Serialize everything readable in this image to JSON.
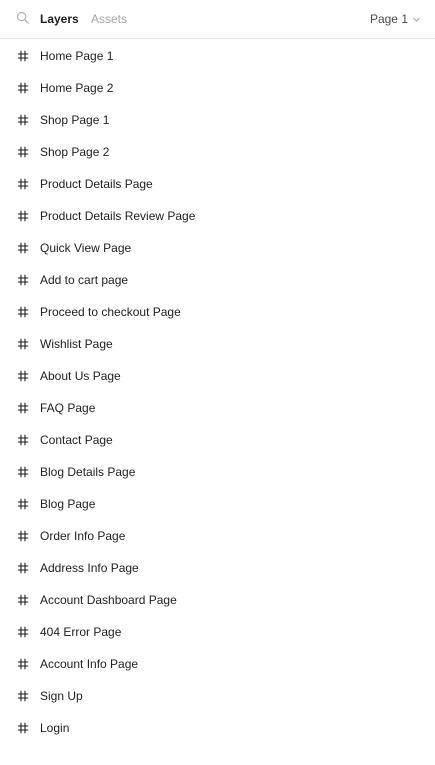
{
  "header": {
    "tabs": [
      {
        "label": "Layers"
      },
      {
        "label": "Assets"
      }
    ],
    "page_selector": {
      "label": "Page 1"
    },
    "search_icon": "search-icon",
    "chevron_icon": "chevron-down-icon"
  },
  "layers": [
    {
      "label": "Home Page 1",
      "icon": "frame-icon"
    },
    {
      "label": "Home Page 2",
      "icon": "frame-icon"
    },
    {
      "label": "Shop Page 1",
      "icon": "frame-icon"
    },
    {
      "label": "Shop Page 2",
      "icon": "frame-icon"
    },
    {
      "label": "Product Details Page",
      "icon": "frame-icon"
    },
    {
      "label": "Product Details Review Page",
      "icon": "frame-icon"
    },
    {
      "label": "Quick View Page",
      "icon": "frame-icon"
    },
    {
      "label": "Add to cart page",
      "icon": "frame-icon"
    },
    {
      "label": "Proceed to checkout Page",
      "icon": "frame-icon"
    },
    {
      "label": "Wishlist Page",
      "icon": "frame-icon"
    },
    {
      "label": "About Us Page",
      "icon": "frame-icon"
    },
    {
      "label": "FAQ Page",
      "icon": "frame-icon"
    },
    {
      "label": "Contact Page",
      "icon": "frame-icon"
    },
    {
      "label": "Blog Details Page",
      "icon": "frame-icon"
    },
    {
      "label": "Blog Page",
      "icon": "frame-icon"
    },
    {
      "label": "Order Info Page",
      "icon": "frame-icon"
    },
    {
      "label": "Address Info Page",
      "icon": "frame-icon"
    },
    {
      "label": "Account Dashboard Page",
      "icon": "frame-icon"
    },
    {
      "label": "404 Error Page",
      "icon": "frame-icon"
    },
    {
      "label": "Account Info Page",
      "icon": "frame-icon"
    },
    {
      "label": "Sign Up",
      "icon": "frame-icon"
    },
    {
      "label": "Login",
      "icon": "frame-icon"
    }
  ],
  "colors": {
    "active_tab": "#1e1e1e",
    "inactive_tab": "#a3a3a3",
    "divider": "#e6e6e6",
    "text": "#1e1e1e"
  }
}
